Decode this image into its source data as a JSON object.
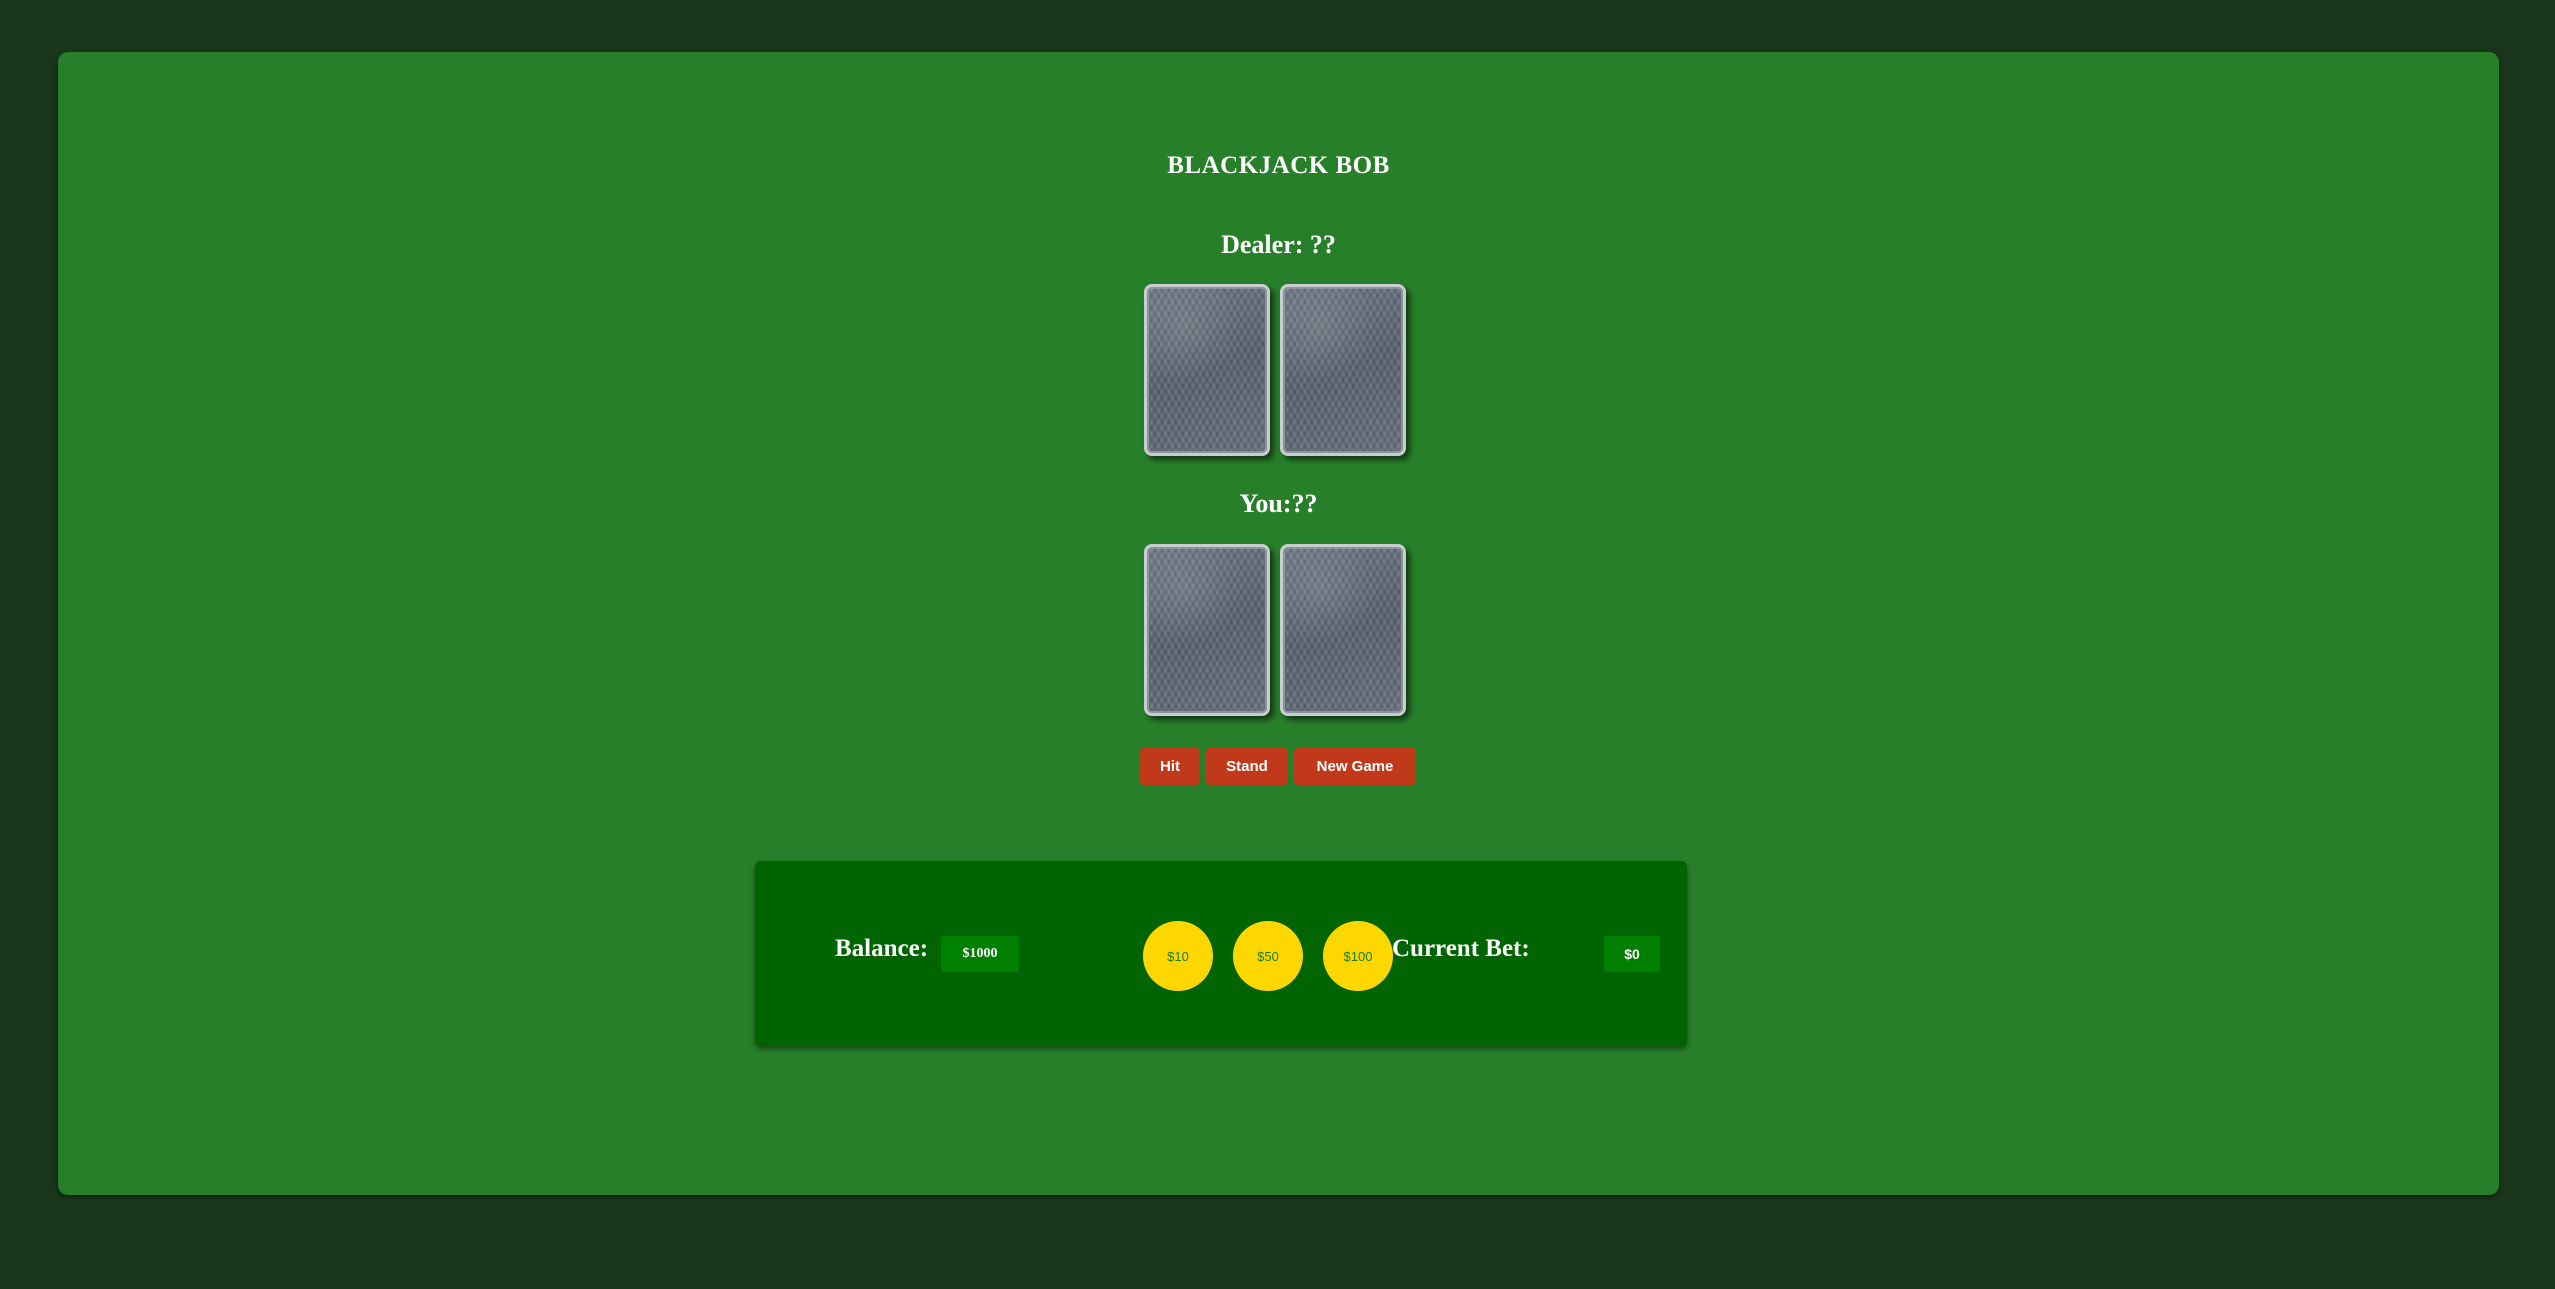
{
  "game": {
    "title": "BLACKJACK BOB"
  },
  "dealer": {
    "label": "Dealer: ??",
    "cards": [
      "card-back",
      "card-back"
    ]
  },
  "player": {
    "label": "You:??",
    "cards": [
      "card-back",
      "card-back"
    ]
  },
  "controls": {
    "hit_label": "Hit",
    "stand_label": "Stand",
    "new_game_label": "New Game"
  },
  "betting": {
    "balance_label": "Balance:",
    "balance_value": "$1000",
    "chips": [
      "$10",
      "$50",
      "$100"
    ],
    "current_bet_label": "Current Bet:",
    "current_bet_value": "$0"
  },
  "colors": {
    "page_background": "#19361b",
    "table_felt": "#277f2a",
    "panel": "#006400",
    "button": "#c0391b",
    "chip": "#ffd700"
  }
}
